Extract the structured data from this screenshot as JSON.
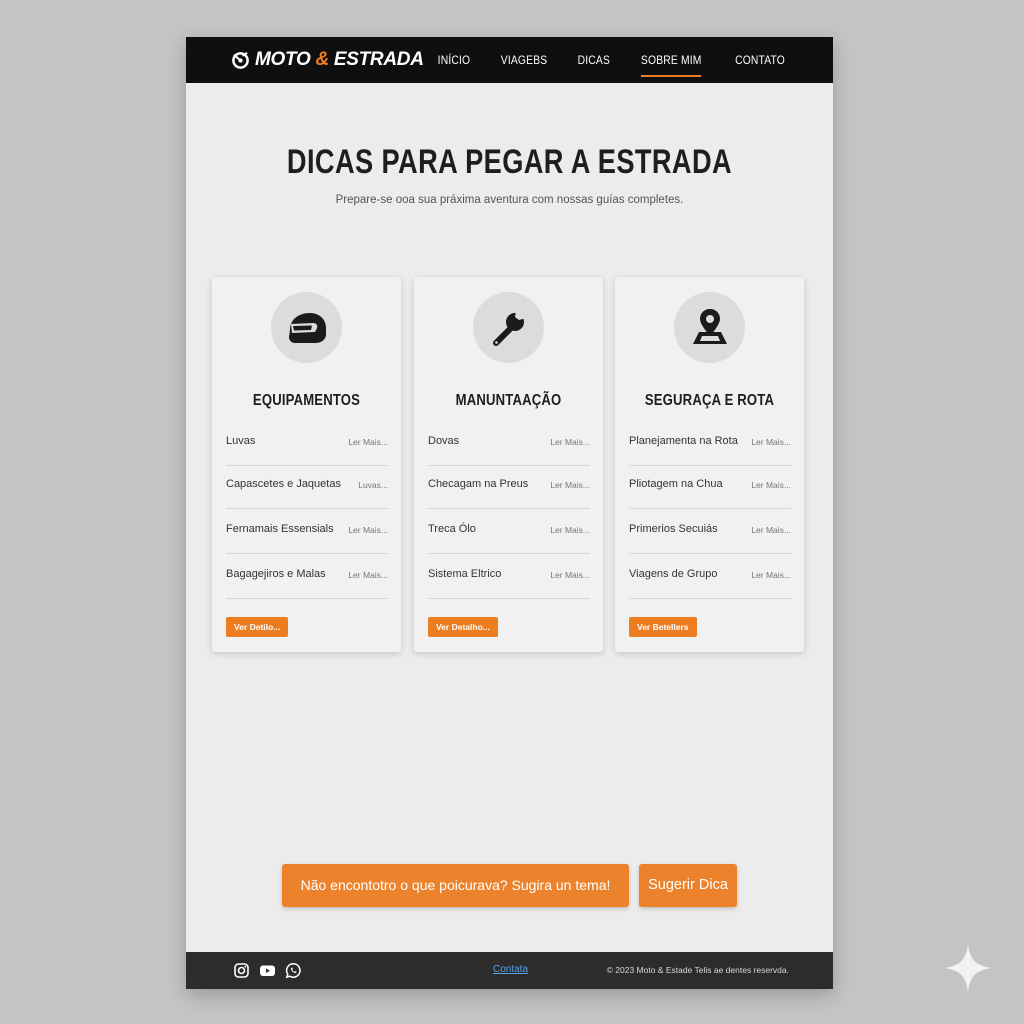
{
  "header": {
    "logo_text_1": "MOTO",
    "logo_amp": "&",
    "logo_text_2": "ESTRADA",
    "nav": [
      {
        "label": "INÍCIO",
        "active": false
      },
      {
        "label": "VIAGEBS",
        "active": false
      },
      {
        "label": "DICAS",
        "active": false
      },
      {
        "label": "SOBRE MIM",
        "active": true
      },
      {
        "label": "CONTATO",
        "active": false
      }
    ]
  },
  "hero": {
    "title": "DICAS PARA PEGAR A ESTRADA",
    "subtitle": "Prepare-se ooa sua práxima aventura com nossas guías completes."
  },
  "cards": [
    {
      "icon": "helmet-icon",
      "title": "EQUIPAMENTOS",
      "items": [
        {
          "name": "Luvas",
          "more": "Ler Mais..."
        },
        {
          "name": "Capascetes e Jaquetas",
          "more": "Luvas..."
        },
        {
          "name": "Fernamais Essensials",
          "more": "Ler Mais..."
        },
        {
          "name": "Bagagejiros e Malas",
          "more": "Ler Mais..."
        }
      ],
      "button": "Ver Detilo..."
    },
    {
      "icon": "wrench-icon",
      "title": "MANUNTAAÇÃO",
      "items": [
        {
          "name": "Dovas",
          "more": "Ler Mais..."
        },
        {
          "name": "Checagam na Preus",
          "more": "Ler Mais..."
        },
        {
          "name": "Treca Ólo",
          "more": "Ler Mais..."
        },
        {
          "name": "Sistema Eltrico",
          "more": "Ler Mais..."
        }
      ],
      "button": "Ver Detalho..."
    },
    {
      "icon": "map-pin-icon",
      "title": "SEGURAÇA E ROTA",
      "items": [
        {
          "name": "Planejamenta na Rota",
          "more": "Ler Mais..."
        },
        {
          "name": "Pliotagem na Chua",
          "more": "Ler Mais..."
        },
        {
          "name": "Primerios Secuiás",
          "more": "Ler Mais..."
        },
        {
          "name": "Viagens de Grupo",
          "more": "Ler Mais..."
        }
      ],
      "button": "Ver Betellers"
    }
  ],
  "cta": {
    "text": "Não encontotro o que poicurava? Sugira un tema!",
    "button": "Sugerir Dica"
  },
  "footer": {
    "social_icons": [
      "instagram-icon",
      "youtube-icon",
      "whatsapp-icon"
    ],
    "link": "Contata",
    "copyright": "© 2023 Moto & Estade  Telis ae dentes reservda."
  },
  "colors": {
    "accent": "#ee7d22",
    "header_bg": "#0f0f0f",
    "page_bg": "#ececec",
    "footer_bg": "#2c2c2c",
    "link": "#5aa2e8"
  }
}
